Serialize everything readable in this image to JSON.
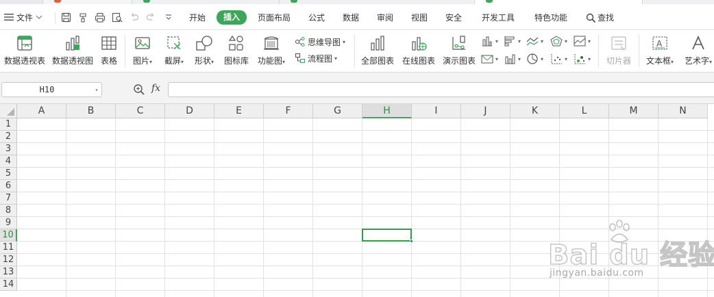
{
  "menu": {
    "file_label": "文件",
    "tabs": [
      "开始",
      "插入",
      "页面布局",
      "公式",
      "数据",
      "审阅",
      "视图",
      "安全",
      "开发工具",
      "特色功能"
    ],
    "active_tab": "插入",
    "search_label": "查找"
  },
  "ribbon": {
    "pivot_table": "数据透视表",
    "pivot_chart": "数据透视图",
    "table": "表格",
    "picture": "图片",
    "screenshot": "截屏",
    "shape": "形状",
    "icon_library": "图标库",
    "function_chart": "功能图",
    "mind_map": "思维导图",
    "flowchart": "流程图",
    "all_charts": "全部图表",
    "online_chart": "在线图表",
    "demo_chart": "演示图表",
    "slicer": "切片器",
    "textbox": "文本框",
    "wordart": "艺术字"
  },
  "formula_bar": {
    "name_box": "H10",
    "fx_label": "fx",
    "formula": ""
  },
  "sheet": {
    "columns": [
      "A",
      "B",
      "C",
      "D",
      "E",
      "F",
      "G",
      "H",
      "I",
      "J",
      "K",
      "L",
      "M",
      "N"
    ],
    "rows": [
      "1",
      "2",
      "3",
      "4",
      "5",
      "6",
      "7",
      "8",
      "9",
      "10",
      "11",
      "12",
      "13",
      "14"
    ],
    "selected_cell": "H10"
  },
  "watermark": {
    "main": "Bai du 经验",
    "sub": "jingyan.baidu.com"
  },
  "colors": {
    "accent_green": "#3ca659",
    "selection_green": "#2e9b48"
  }
}
